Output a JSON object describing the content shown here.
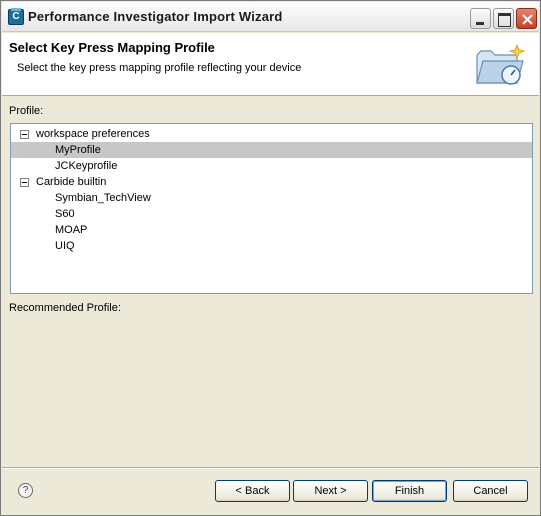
{
  "window": {
    "title": "Performance Investigator Import Wizard",
    "app_icon_letter": "C"
  },
  "banner": {
    "title": "Select Key Press Mapping Profile",
    "description": "Select the key press mapping profile reflecting your device",
    "graphic_icon": "folder-gauge-icon"
  },
  "profile": {
    "label": "Profile:",
    "groups": [
      {
        "label": "workspace preferences",
        "expanded": true,
        "items": [
          {
            "label": "MyProfile",
            "selected": true
          },
          {
            "label": "JCKeyprofile",
            "selected": false
          }
        ]
      },
      {
        "label": "Carbide builtin",
        "expanded": true,
        "items": [
          {
            "label": "Symbian_TechView",
            "selected": false
          },
          {
            "label": "S60",
            "selected": false
          },
          {
            "label": "MOAP",
            "selected": false
          },
          {
            "label": "UIQ",
            "selected": false
          }
        ]
      }
    ]
  },
  "recommended": {
    "label": "Recommended Profile:",
    "value": ""
  },
  "buttons": {
    "back": "< Back",
    "next": "Next >",
    "finish": "Finish",
    "cancel": "Cancel",
    "help": "?"
  }
}
